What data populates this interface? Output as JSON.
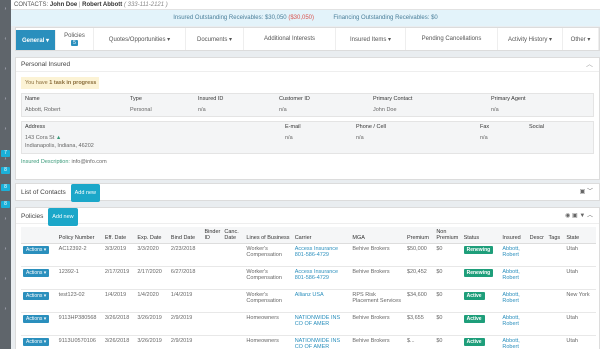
{
  "sidebar_marks": [
    "›",
    "‹",
    "›",
    "›",
    "›",
    "›",
    "‹",
    "›",
    "›",
    "›",
    "›"
  ],
  "sidebar_badges": [
    "7",
    "8",
    "8",
    "8"
  ],
  "contacts": {
    "prefix": "CONTACTS:",
    "name1": "John Doe",
    "name2": "Robert Abbott",
    "phone": "( 333-111-2121 )"
  },
  "receivables": {
    "insured_label": "Insured Outstanding Receivables:",
    "insured_value": "$30,050",
    "insured_red": "($30,050)",
    "financing_label": "Financing Outstanding Receivables:",
    "financing_value": "$0"
  },
  "tabs": [
    {
      "label": "General ▾",
      "w": 40
    },
    {
      "label": "Policies",
      "count": "5",
      "w": 38
    },
    {
      "label": "Quotes/Opportunities ▾",
      "w": 92
    },
    {
      "label": "Documents ▾",
      "w": 58
    },
    {
      "label": "Additional Interests",
      "w": 92
    },
    {
      "label": "Insured Items ▾",
      "w": 70
    },
    {
      "label": "Pending Cancellations",
      "w": 92
    },
    {
      "label": "Activity History ▾",
      "w": 65
    },
    {
      "label": "Other ▾",
      "w": 36
    }
  ],
  "personal": {
    "title": "Personal Insured",
    "task_text": "You have",
    "task_bold": "1 task in progress",
    "headers": {
      "name": "Name",
      "type": "Type",
      "insured_id": "Insured ID",
      "customer_id": "Customer ID",
      "primary_contact": "Primary Contact",
      "primary_agent": "Primary Agent"
    },
    "values": {
      "name": "Abbott, Robert",
      "type": "Personal",
      "insured_id": "n/a",
      "customer_id": "n/a",
      "primary_contact": "John Doe",
      "primary_agent": "n/a"
    },
    "addr_headers": {
      "address": "Address",
      "email": "E-mail",
      "phone": "Phone / Cell",
      "fax": "Fax",
      "social": "Social"
    },
    "addr_values": {
      "line1": "143 Cora St",
      "line2": "Indianapolis, Indiana, 46202",
      "email": "n/a",
      "phone": "n/a",
      "fax": "n/a"
    },
    "desc_label": "Insured Description:",
    "desc_value": "info@info.com"
  },
  "contacts_panel": {
    "title": "List of Contacts",
    "add": "Add new"
  },
  "policies": {
    "title": "Policies",
    "add": "Add new",
    "columns": [
      "",
      "Policy Number",
      "Eff. Date",
      "Exp. Date",
      "Bind Date",
      "Binder ID",
      "Canc. Date",
      "Lines of Business",
      "Carrier",
      "MGA",
      "Premium",
      "Non Premium",
      "Status",
      "Insured",
      "Descr",
      "Tags",
      "State"
    ],
    "rows": [
      [
        "Actions ▾",
        "AC12392-2",
        "3/3/2019",
        "3/3/2020",
        "2/23/2018",
        "",
        "",
        "Worker's Compensation",
        "Access Insurance 801-586-4729",
        "Behive Brokers",
        "$50,000",
        "$0",
        "Renewing",
        "Abbott, Robert",
        "",
        "",
        "Utah"
      ],
      [
        "Actions ▾",
        "12392-1",
        "2/17/2019",
        "2/17/2020",
        "6/27/2018",
        "",
        "",
        "Worker's Compensation",
        "Access Insurance 801-586-4729",
        "Behive Brokers",
        "$20,452",
        "$0",
        "Renewing",
        "Abbott, Robert",
        "",
        "",
        "Utah"
      ],
      [
        "Actions ▾",
        "test123-02",
        "1/4/2019",
        "1/4/2020",
        "1/4/2019",
        "",
        "",
        "Worker's Compensation",
        "Allianz USA",
        "RPS Risk Placement Services",
        "$34,600",
        "$0",
        "Active",
        "Abbott, Robert",
        "",
        "",
        "New York"
      ],
      [
        "Actions ▾",
        "9113HP380568",
        "3/26/2018",
        "3/26/2019",
        "2/9/2019",
        "",
        "",
        "Homeowners",
        "NATIONWIDE INS CO OF AMER",
        "Behive Brokers",
        "$3,655",
        "$0",
        "Active",
        "Abbott, Robert",
        "",
        "",
        "Utah"
      ],
      [
        "Actions ▾",
        "9113U0570106",
        "3/26/2018",
        "3/26/2019",
        "2/9/2019",
        "",
        "",
        "Homeowners",
        "NATIONWIDE INS CO OF AMER",
        "Behive Brokers",
        "$...",
        "$0",
        "Active",
        "Abbott, Robert",
        "",
        "",
        "Utah"
      ]
    ]
  }
}
